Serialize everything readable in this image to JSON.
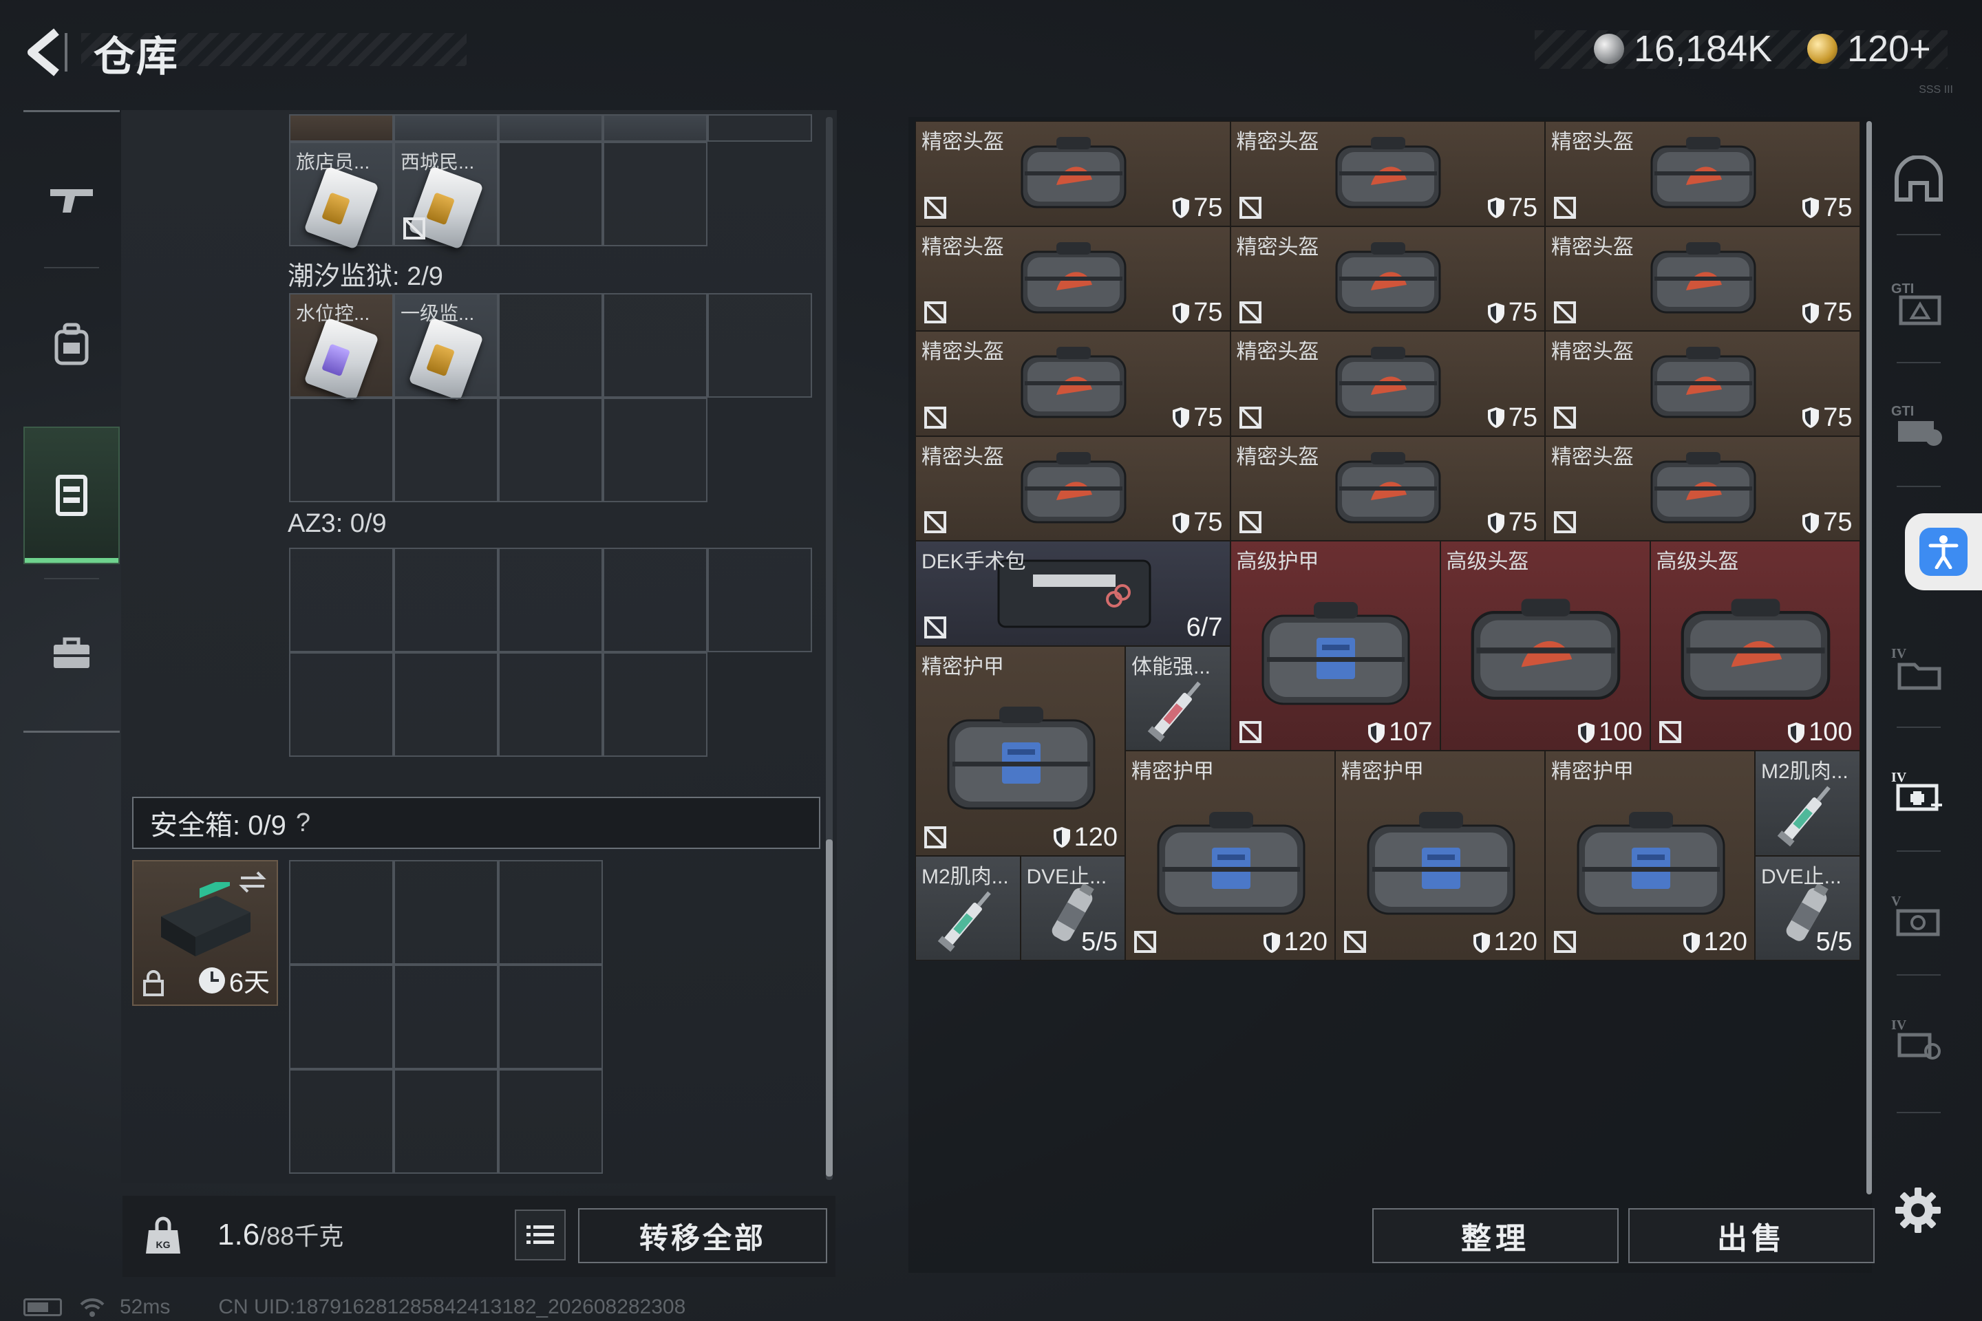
{
  "header": {
    "title": "仓库",
    "currency_silver": "16,184K",
    "currency_gold": "120+",
    "build_tag": "SSS III"
  },
  "left_nav": {
    "items": [
      {
        "name": "weapon",
        "icon": "gun-icon"
      },
      {
        "name": "backpack",
        "icon": "backpack-icon"
      },
      {
        "name": "vest",
        "icon": "vest-icon",
        "active": true
      },
      {
        "name": "case",
        "icon": "briefcase-icon"
      }
    ]
  },
  "containers": {
    "row0_labels": [
      "旅店员...",
      "西城民..."
    ],
    "tidal_prison_label": "潮汐监狱: 2/9",
    "tidal_labels": [
      "水位控...",
      "一级监..."
    ],
    "az3_label": "AZ3: 0/9",
    "safebox_label": "安全箱: 0/9",
    "safebox_help": "?",
    "safebox_time": "6天"
  },
  "bottom_left": {
    "weight_value": "1.6",
    "weight_max": "/88千克",
    "transfer_all": "转移全部"
  },
  "status": {
    "ping": "52ms",
    "uid": "CN UID:18791628128584241318​2_202608282308"
  },
  "stash": {
    "helmet_name": "精密头盔",
    "helmet_dur": "75",
    "items": {
      "dek_name": "DEK手术包",
      "dek_count": "6/7",
      "adv_armor_name": "高级护甲",
      "adv_armor_dur": "107",
      "adv_helmet_name": "高级头盔",
      "adv_helmet_dur": "100",
      "precise_armor_name": "精密护甲",
      "precise_armor_dur": "120",
      "stamina_name": "体能强...",
      "m2_name": "M2肌肉...",
      "dve_name": "DVE止...",
      "dve_count": "5/5"
    },
    "sort_button": "整理",
    "sell_button": "出售"
  },
  "colors": {
    "accent_green": "#6fd38e",
    "item_brown": "#4e4136",
    "item_red": "#6a2f31",
    "accessibility_blue": "#3d8cf2"
  }
}
